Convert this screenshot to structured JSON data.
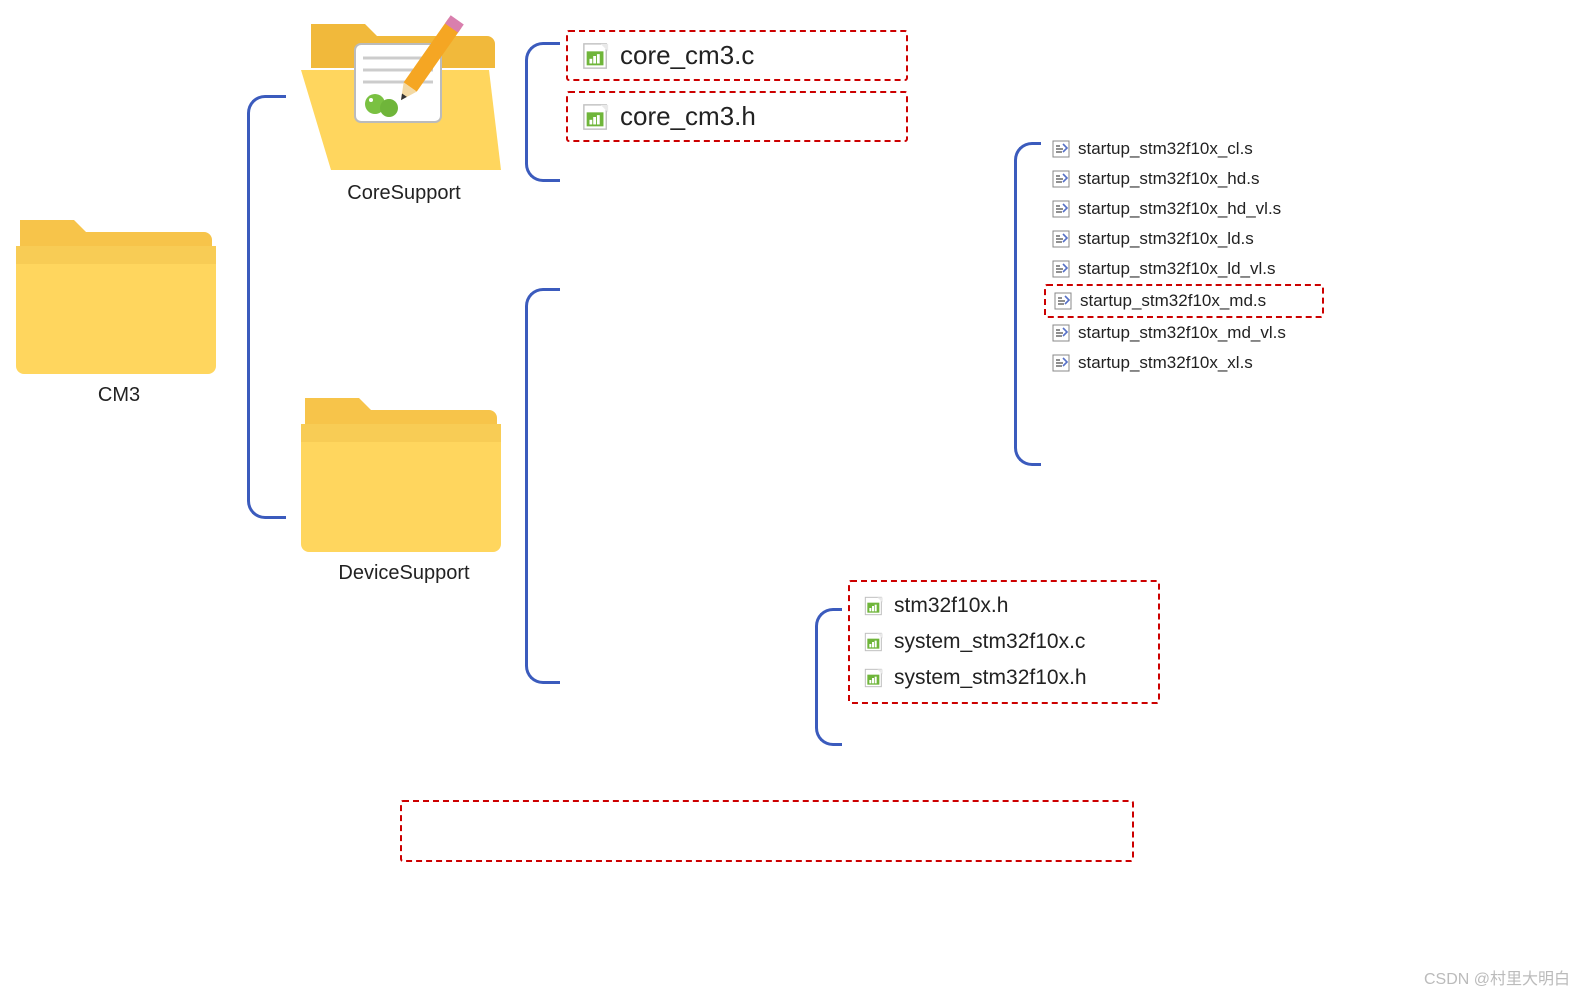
{
  "root_folder": {
    "label": "CM3"
  },
  "subfolders": {
    "core": {
      "label": "CoreSupport"
    },
    "device": {
      "label": "DeviceSupport"
    }
  },
  "core_files": {
    "f0": "core_cm3.c",
    "f1": "core_cm3.h"
  },
  "startup_files": {
    "s0": "startup_stm32f10x_cl.s",
    "s1": "startup_stm32f10x_hd.s",
    "s2": "startup_stm32f10x_hd_vl.s",
    "s3": "startup_stm32f10x_ld.s",
    "s4": "startup_stm32f10x_ld_vl.s",
    "s5": "startup_stm32f10x_md.s",
    "s6": "startup_stm32f10x_md_vl.s",
    "s7": "startup_stm32f10x_xl.s"
  },
  "system_files": {
    "d0": "stm32f10x.h",
    "d1": "system_stm32f10x.c",
    "d2": "system_stm32f10x.h"
  },
  "watermark": "CSDN @村里大明白"
}
